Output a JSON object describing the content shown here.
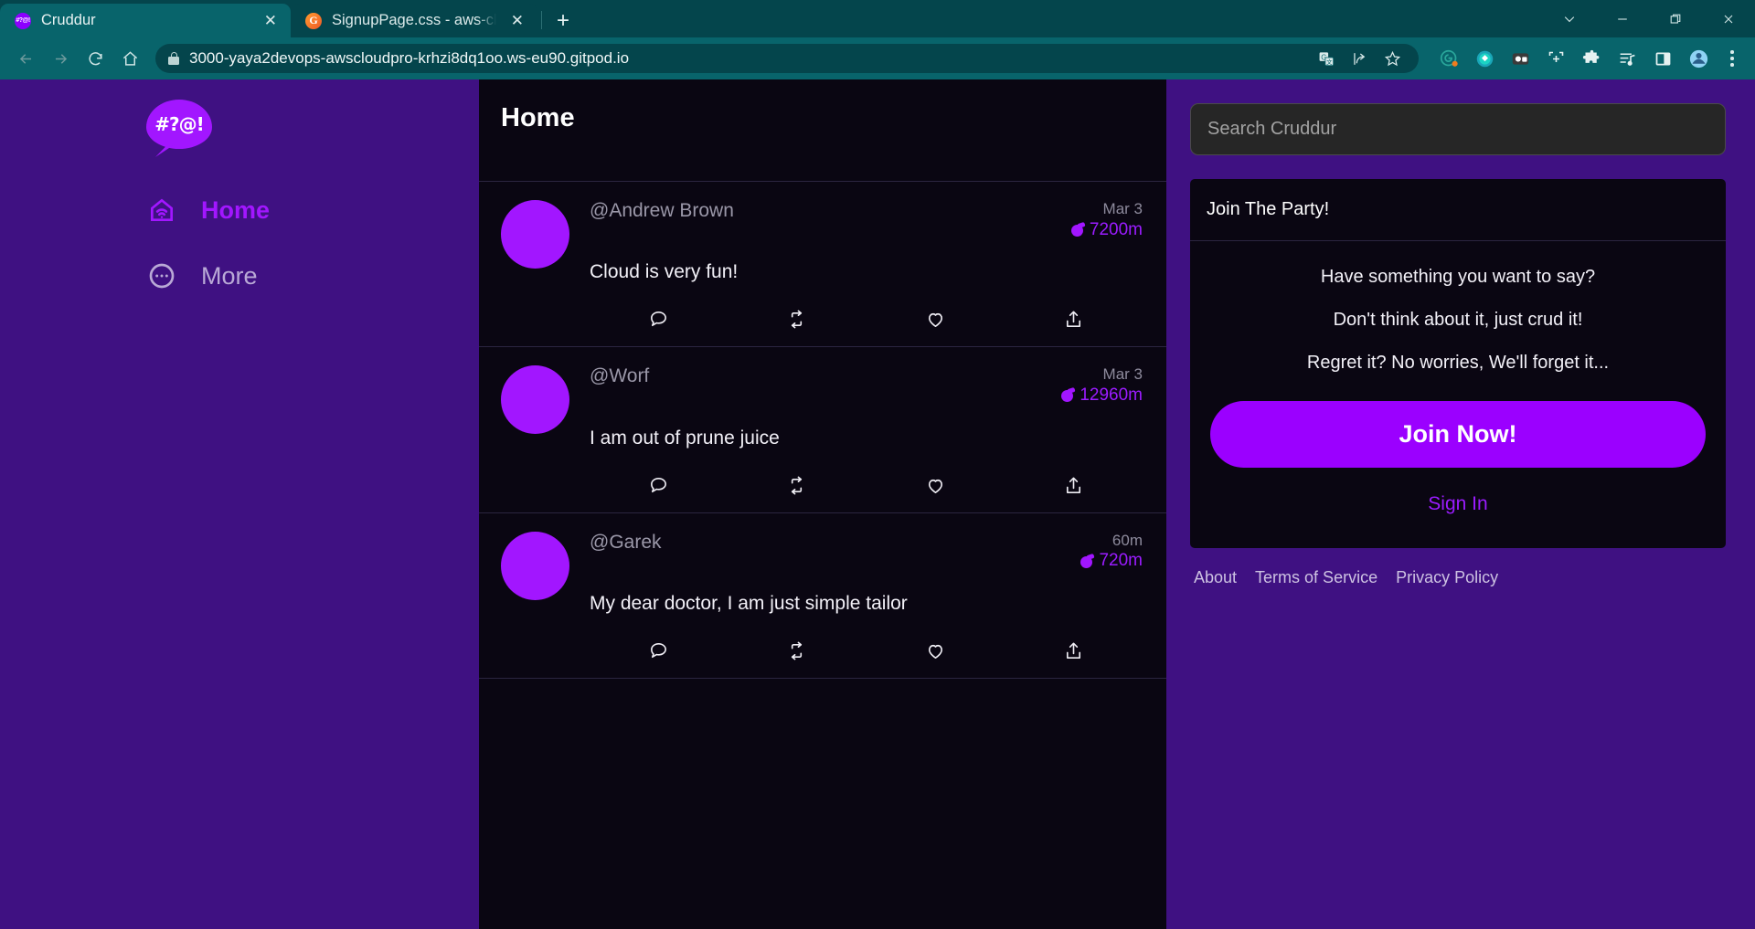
{
  "browser": {
    "tabs": [
      {
        "title": "Cruddur",
        "favicon": "cruddur-icon",
        "active": true
      },
      {
        "title": "SignupPage.css - aws-cloud-proj",
        "favicon": "gitpod-icon",
        "active": false
      }
    ],
    "new_tab_label": "+",
    "window_controls": {
      "minimize_group": "⌄",
      "minimize": "—",
      "maximize": "❐",
      "close": "✕"
    },
    "toolbar": {
      "back": "back-arrow",
      "forward": "forward-arrow",
      "reload": "reload",
      "home": "home",
      "url": "3000-yaya2devops-awscloudpro-krhzi8dq1oo.ws-eu90.gitpod.io",
      "secure": true
    }
  },
  "app": {
    "logo_text": "#?@!",
    "nav": [
      {
        "label": "Home",
        "icon": "home-icon",
        "active": true
      },
      {
        "label": "More",
        "icon": "ellipsis-circle-icon",
        "active": false
      }
    ],
    "feed": {
      "title": "Home",
      "posts": [
        {
          "handle": "@Andrew Brown",
          "date": "Mar 3",
          "expires": "7200m",
          "message": "Cloud is very fun!"
        },
        {
          "handle": "@Worf",
          "date": "Mar 3",
          "expires": "12960m",
          "message": "I am out of prune juice"
        },
        {
          "handle": "@Garek",
          "date": "60m",
          "expires": "720m",
          "message": "My dear doctor, I am just simple tailor"
        }
      ],
      "actions": [
        "reply-icon",
        "repost-icon",
        "like-icon",
        "share-icon"
      ]
    },
    "sidebar": {
      "search_placeholder": "Search Cruddur",
      "search_value": "",
      "join_card": {
        "title": "Join The Party!",
        "lines": [
          "Have something you want to say?",
          "Don't think about it, just crud it!",
          "Regret it? No worries, We'll forget it..."
        ],
        "join_button": "Join Now!",
        "signin_link": "Sign In"
      },
      "footer_links": [
        "About",
        "Terms of Service",
        "Privacy Policy"
      ]
    }
  },
  "colors": {
    "brand_purple": "#a216ff",
    "page_purple": "#3f1182",
    "panel_black": "#0a0612",
    "browser_teal": "#08646b",
    "tabstrip_teal": "#04454c"
  }
}
